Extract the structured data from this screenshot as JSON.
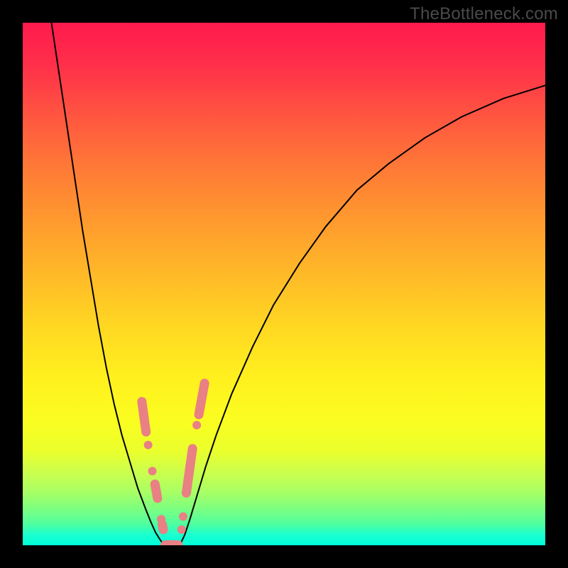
{
  "watermark": "TheBottleneck.com",
  "colors": {
    "frame": "#000000",
    "curve": "#000000",
    "marker": "#e98083"
  },
  "chart_data": {
    "type": "line",
    "title": "",
    "xlabel": "",
    "ylabel": "",
    "xlim": [
      0,
      100
    ],
    "ylim": [
      0,
      100
    ],
    "grid": false,
    "legend": null,
    "series": [
      {
        "name": "left-branch",
        "x": [
          5.5,
          7,
          8.5,
          10,
          11.5,
          13,
          14.5,
          16,
          17.5,
          19,
          20.5,
          22,
          23.5,
          24.5,
          25.4,
          26.2,
          26.9
        ],
        "y": [
          100,
          90,
          80,
          70,
          60,
          51,
          42,
          34,
          27,
          21,
          16,
          11,
          7,
          4.5,
          2.5,
          1.2,
          0.2
        ]
      },
      {
        "name": "valley-floor",
        "x": [
          27,
          27.5,
          28,
          28.5,
          29,
          29.5,
          30
        ],
        "y": [
          0,
          0,
          0,
          0,
          0,
          0,
          0
        ]
      },
      {
        "name": "right-branch",
        "x": [
          30.2,
          31,
          32,
          33.5,
          35,
          37,
          40,
          44,
          48,
          53,
          58,
          64,
          70,
          77,
          84,
          92,
          100
        ],
        "y": [
          0.3,
          2,
          5,
          10,
          15,
          21,
          29,
          38,
          46,
          54,
          61,
          68,
          73,
          78,
          82,
          85.5,
          88
        ]
      }
    ],
    "markers": {
      "left_branch": [
        {
          "x": 22.8,
          "y": 27.5
        },
        {
          "x": 23.0,
          "y": 25.5
        },
        {
          "x": 23.3,
          "y": 23.5
        },
        {
          "x": 23.6,
          "y": 21.7
        },
        {
          "x": 24.0,
          "y": 19.2
        },
        {
          "x": 24.8,
          "y": 14.2
        },
        {
          "x": 25.3,
          "y": 11.7
        },
        {
          "x": 25.8,
          "y": 9.0
        },
        {
          "x": 26.5,
          "y": 5.0
        },
        {
          "x": 26.7,
          "y": 4.0
        },
        {
          "x": 26.9,
          "y": 3.0
        }
      ],
      "right_branch": [
        {
          "x": 30.4,
          "y": 3.0
        },
        {
          "x": 30.7,
          "y": 5.5
        },
        {
          "x": 31.3,
          "y": 10.0
        },
        {
          "x": 31.6,
          "y": 12.3
        },
        {
          "x": 31.9,
          "y": 14.5
        },
        {
          "x": 32.2,
          "y": 16.5
        },
        {
          "x": 32.5,
          "y": 18.5
        },
        {
          "x": 33.3,
          "y": 23.0
        },
        {
          "x": 33.7,
          "y": 25.0
        },
        {
          "x": 34.0,
          "y": 27.0
        },
        {
          "x": 34.4,
          "y": 29.0
        },
        {
          "x": 34.8,
          "y": 31.0
        }
      ],
      "floor": [
        {
          "x": 27.3,
          "y": 0
        },
        {
          "x": 27.9,
          "y": 0
        },
        {
          "x": 28.5,
          "y": 0
        },
        {
          "x": 29.1,
          "y": 0
        },
        {
          "x": 29.7,
          "y": 0
        }
      ]
    }
  }
}
